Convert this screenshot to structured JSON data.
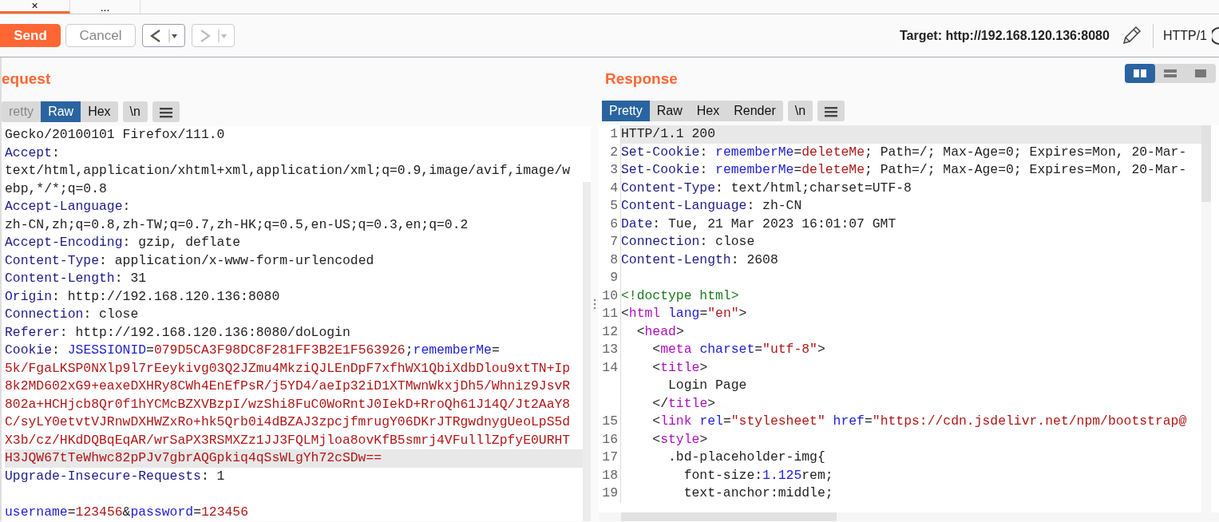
{
  "top_tabs": [
    {
      "label": "×",
      "selected": true
    },
    {
      "label": "...",
      "selected": false
    }
  ],
  "toolbar": {
    "send": "Send",
    "cancel": "Cancel",
    "history": [
      {
        "kind": "back",
        "disabled": false
      },
      {
        "kind": "forward",
        "disabled": true
      }
    ],
    "target": "Target: http://192.168.120.136:8080",
    "protocol": "HTTP/1"
  },
  "request": {
    "title": "equest",
    "tabs": [
      {
        "label": "retty",
        "selected": false,
        "disabled": true
      },
      {
        "label": "Raw",
        "selected": true,
        "disabled": false
      },
      {
        "label": "Hex",
        "selected": false,
        "disabled": false
      }
    ],
    "newline_button": "\\n",
    "rows": [
      {
        "highlighted": false,
        "segments": [
          {
            "kind": "plain",
            "text": "Gecko/20100101 Firefox/111.0"
          }
        ]
      },
      {
        "highlighted": false,
        "segments": [
          {
            "kind": "header",
            "text": "Accept"
          },
          {
            "kind": "plain",
            "text": ":"
          }
        ]
      },
      {
        "highlighted": false,
        "segments": [
          {
            "kind": "plain",
            "text": "text/html,application/xhtml+xml,application/xml;q=0.9,image/avif,image/w"
          }
        ]
      },
      {
        "highlighted": false,
        "segments": [
          {
            "kind": "plain",
            "text": "ebp,*/*;q=0.8"
          }
        ]
      },
      {
        "highlighted": false,
        "segments": [
          {
            "kind": "header",
            "text": "Accept-Language"
          },
          {
            "kind": "plain",
            "text": ":"
          }
        ]
      },
      {
        "highlighted": false,
        "segments": [
          {
            "kind": "plain",
            "text": "zh-CN,zh;q=0.8,zh-TW;q=0.7,zh-HK;q=0.5,en-US;q=0.3,en;q=0.2"
          }
        ]
      },
      {
        "highlighted": false,
        "segments": [
          {
            "kind": "header",
            "text": "Accept-Encoding"
          },
          {
            "kind": "plain",
            "text": ": gzip, deflate"
          }
        ]
      },
      {
        "highlighted": false,
        "segments": [
          {
            "kind": "header",
            "text": "Content-Type"
          },
          {
            "kind": "plain",
            "text": ": application/x-www-form-urlencoded"
          }
        ]
      },
      {
        "highlighted": false,
        "segments": [
          {
            "kind": "header",
            "text": "Content-Length"
          },
          {
            "kind": "plain",
            "text": ": 31"
          }
        ]
      },
      {
        "highlighted": false,
        "segments": [
          {
            "kind": "header",
            "text": "Origin"
          },
          {
            "kind": "plain",
            "text": ": http://192.168.120.136:8080"
          }
        ]
      },
      {
        "highlighted": false,
        "segments": [
          {
            "kind": "header",
            "text": "Connection"
          },
          {
            "kind": "plain",
            "text": ": close"
          }
        ]
      },
      {
        "highlighted": false,
        "segments": [
          {
            "kind": "header",
            "text": "Referer"
          },
          {
            "kind": "plain",
            "text": ": http://192.168.120.136:8080/doLogin"
          }
        ]
      },
      {
        "highlighted": false,
        "segments": [
          {
            "kind": "header",
            "text": "Cookie"
          },
          {
            "kind": "plain",
            "text": ": "
          },
          {
            "kind": "name",
            "text": "JSESSIONID"
          },
          {
            "kind": "plain",
            "text": "="
          },
          {
            "kind": "value",
            "text": "079D5CA3F98DC8F281FF3B2E1F563926"
          },
          {
            "kind": "plain",
            "text": ";"
          },
          {
            "kind": "name",
            "text": "rememberMe"
          },
          {
            "kind": "plain",
            "text": "="
          }
        ]
      },
      {
        "highlighted": false,
        "segments": [
          {
            "kind": "value",
            "text": "5k/FgaLKSP0NXlp9l7rEeykivg03Q2JZmu4MkziQJLEnDpF7xfhWX1QbiXdbDlou9xtTN+Ip"
          }
        ]
      },
      {
        "highlighted": false,
        "segments": [
          {
            "kind": "value",
            "text": "8k2MD602xG9+eaxeDXHRy8CWh4EnEfPsR/j5YD4/aeIp32iD1XTMwnWkxjDh5/Whniz9JsvR"
          }
        ]
      },
      {
        "highlighted": false,
        "segments": [
          {
            "kind": "value",
            "text": "802a+HCHjcb8Qr0f1hYCMcBZXVBzpI/wzShi8FuC0WoRntJ0IekD+RroQh61J14Q/Jt2AaY8"
          }
        ]
      },
      {
        "highlighted": false,
        "segments": [
          {
            "kind": "value",
            "text": "C/syLY0etvtVJRnwDXHWZxRo+hk5Qrb0i4dBZAJ3zpcjfmrugY06DKrJTRgwdnygUeoLpS5d"
          }
        ]
      },
      {
        "highlighted": false,
        "segments": [
          {
            "kind": "value",
            "text": "X3b/cz/HKdDQBqEqAR/wrSaPX3RSMXZz1JJ3FQLMjloa8ovKfB5smrj4VFulllZpfyE0URHT"
          }
        ]
      },
      {
        "highlighted": true,
        "segments": [
          {
            "kind": "value",
            "text": "H3JQW67tTeWhwc82pPJv7gbrAQGpkiq4qSsWLgYh72cSDw=="
          }
        ]
      },
      {
        "highlighted": false,
        "segments": [
          {
            "kind": "header",
            "text": "Upgrade-Insecure-Requests"
          },
          {
            "kind": "plain",
            "text": ": 1"
          }
        ]
      },
      {
        "highlighted": false
      },
      {
        "highlighted": false,
        "segments": [
          {
            "kind": "name",
            "text": "username"
          },
          {
            "kind": "plain",
            "text": "="
          },
          {
            "kind": "value",
            "text": "123456"
          },
          {
            "kind": "plain",
            "text": "&"
          },
          {
            "kind": "name",
            "text": "password"
          },
          {
            "kind": "plain",
            "text": "="
          },
          {
            "kind": "value",
            "text": "123456"
          }
        ]
      }
    ]
  },
  "response": {
    "title": "Response",
    "view_toggles": [
      {
        "kind": "side-by-side",
        "selected": true
      },
      {
        "kind": "stacked",
        "selected": false
      },
      {
        "kind": "single",
        "selected": false
      }
    ],
    "tabs": [
      {
        "label": "Pretty",
        "selected": true,
        "disabled": false
      },
      {
        "label": "Raw",
        "selected": false,
        "disabled": false
      },
      {
        "label": "Hex",
        "selected": false,
        "disabled": false
      },
      {
        "label": "Render",
        "selected": false,
        "disabled": false
      }
    ],
    "newline_button": "\\n",
    "rows": [
      {
        "number": "1",
        "highlighted": true,
        "segments": [
          {
            "kind": "plain",
            "text": "HTTP/1.1 200"
          }
        ]
      },
      {
        "number": "2",
        "highlighted": false,
        "segments": [
          {
            "kind": "header",
            "text": "Set-Cookie"
          },
          {
            "kind": "plain",
            "text": ": "
          },
          {
            "kind": "name",
            "text": "rememberMe"
          },
          {
            "kind": "plain",
            "text": "="
          },
          {
            "kind": "value",
            "text": "deleteMe"
          },
          {
            "kind": "plain",
            "text": "; Path=/; Max-Age=0; Expires=Mon, 20-Mar-"
          }
        ]
      },
      {
        "number": "3",
        "highlighted": false,
        "segments": [
          {
            "kind": "header",
            "text": "Set-Cookie"
          },
          {
            "kind": "plain",
            "text": ": "
          },
          {
            "kind": "name",
            "text": "rememberMe"
          },
          {
            "kind": "plain",
            "text": "="
          },
          {
            "kind": "value",
            "text": "deleteMe"
          },
          {
            "kind": "plain",
            "text": "; Path=/; Max-Age=0; Expires=Mon, 20-Mar-"
          }
        ]
      },
      {
        "number": "4",
        "highlighted": false,
        "segments": [
          {
            "kind": "header",
            "text": "Content-Type"
          },
          {
            "kind": "plain",
            "text": ": text/html;charset=UTF-8"
          }
        ]
      },
      {
        "number": "5",
        "highlighted": false,
        "segments": [
          {
            "kind": "header",
            "text": "Content-Language"
          },
          {
            "kind": "plain",
            "text": ": zh-CN"
          }
        ]
      },
      {
        "number": "6",
        "highlighted": false,
        "segments": [
          {
            "kind": "header",
            "text": "Date"
          },
          {
            "kind": "plain",
            "text": ": Tue, 21 Mar 2023 16:01:07 GMT"
          }
        ]
      },
      {
        "number": "7",
        "highlighted": false,
        "segments": [
          {
            "kind": "header",
            "text": "Connection"
          },
          {
            "kind": "plain",
            "text": ": close"
          }
        ]
      },
      {
        "number": "8",
        "highlighted": false,
        "segments": [
          {
            "kind": "header",
            "text": "Content-Length"
          },
          {
            "kind": "plain",
            "text": ": 2608"
          }
        ]
      },
      {
        "number": "9",
        "highlighted": false
      },
      {
        "number": "10",
        "highlighted": false,
        "segments": [
          {
            "kind": "doctype",
            "text": "<!doctype html>"
          }
        ]
      },
      {
        "number": "11",
        "highlighted": false,
        "segments": [
          {
            "kind": "plain",
            "text": "<"
          },
          {
            "kind": "tag",
            "text": "html "
          },
          {
            "kind": "name",
            "text": "lang"
          },
          {
            "kind": "plain",
            "text": "="
          },
          {
            "kind": "value",
            "text": "\"en\""
          },
          {
            "kind": "plain",
            "text": ">"
          }
        ]
      },
      {
        "number": "12",
        "highlighted": false,
        "segments": [
          {
            "kind": "plain",
            "text": "  <"
          },
          {
            "kind": "tag",
            "text": "head"
          },
          {
            "kind": "plain",
            "text": ">"
          }
        ]
      },
      {
        "number": "13",
        "highlighted": false,
        "segments": [
          {
            "kind": "plain",
            "text": "    <"
          },
          {
            "kind": "tag",
            "text": "meta "
          },
          {
            "kind": "name",
            "text": "charset"
          },
          {
            "kind": "plain",
            "text": "="
          },
          {
            "kind": "value",
            "text": "\"utf-8\""
          },
          {
            "kind": "plain",
            "text": ">"
          }
        ]
      },
      {
        "number": "14",
        "highlighted": false,
        "segments": [
          {
            "kind": "plain",
            "text": "    <"
          },
          {
            "kind": "tag",
            "text": "title"
          },
          {
            "kind": "plain",
            "text": ">"
          }
        ]
      },
      {
        "highlighted": false,
        "segments": [
          {
            "kind": "plain",
            "text": "      Login Page"
          }
        ]
      },
      {
        "highlighted": false,
        "segments": [
          {
            "kind": "plain",
            "text": "    </"
          },
          {
            "kind": "tag",
            "text": "title"
          },
          {
            "kind": "plain",
            "text": ">"
          }
        ]
      },
      {
        "number": "15",
        "highlighted": false,
        "segments": [
          {
            "kind": "plain",
            "text": "    <"
          },
          {
            "kind": "tag",
            "text": "link "
          },
          {
            "kind": "name",
            "text": "rel"
          },
          {
            "kind": "plain",
            "text": "="
          },
          {
            "kind": "value",
            "text": "\"stylesheet\" "
          },
          {
            "kind": "name",
            "text": "href"
          },
          {
            "kind": "plain",
            "text": "="
          },
          {
            "kind": "value",
            "text": "\"https://cdn.jsdelivr.net/npm/bootstrap@"
          }
        ]
      },
      {
        "number": "16",
        "highlighted": false,
        "segments": [
          {
            "kind": "plain",
            "text": "    <"
          },
          {
            "kind": "tag",
            "text": "style"
          },
          {
            "kind": "plain",
            "text": ">"
          }
        ]
      },
      {
        "number": "17",
        "highlighted": false,
        "segments": [
          {
            "kind": "plain",
            "text": "      .bd-placeholder-img{"
          }
        ]
      },
      {
        "number": "18",
        "highlighted": false,
        "segments": [
          {
            "kind": "plain",
            "text": "        font-size:"
          },
          {
            "kind": "name",
            "text": "1.125"
          },
          {
            "kind": "plain",
            "text": "rem;"
          }
        ]
      },
      {
        "number": "19",
        "highlighted": false,
        "segments": [
          {
            "kind": "plain",
            "text": "        text-anchor:middle;"
          }
        ]
      }
    ]
  }
}
